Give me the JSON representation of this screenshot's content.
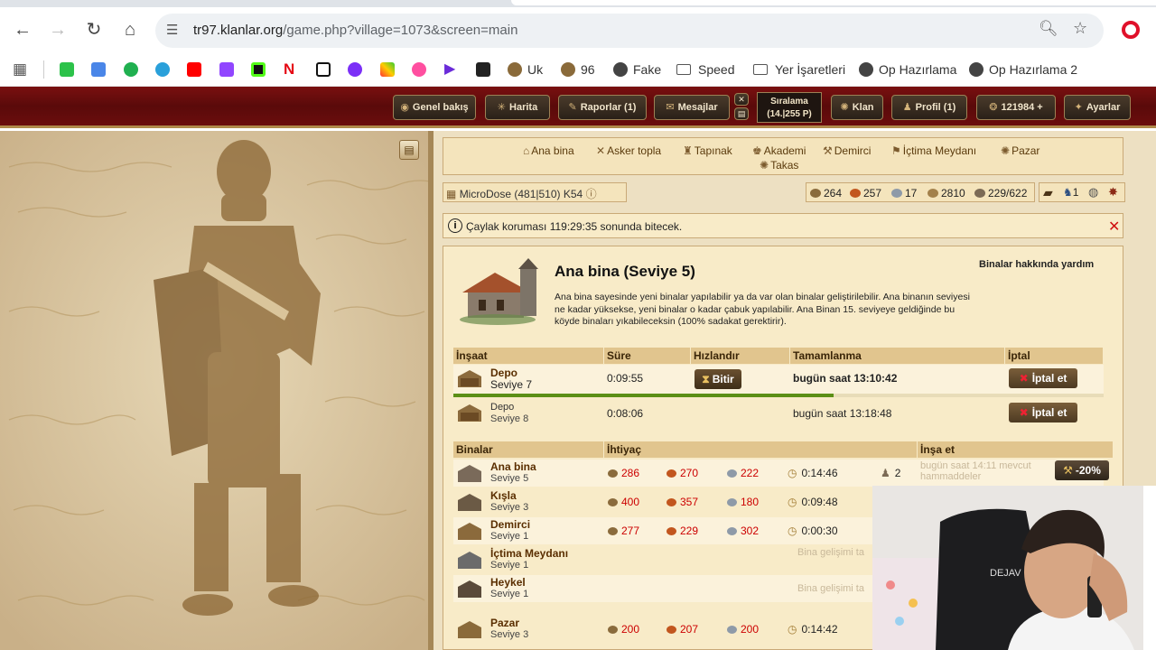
{
  "browser": {
    "url_host": "tr97.klanlar.org",
    "url_path": "/game.php?village=1073&screen=main",
    "bookmarks": [
      "Uk",
      "96",
      "Fake",
      "Speed",
      "Yer İşaretleri",
      "Op Hazırlama",
      "Op Hazırlama 2"
    ]
  },
  "topnav": {
    "overview": "Genel bakış",
    "map": "Harita",
    "reports": "Raporlar (1)",
    "messages": "Mesajlar",
    "rank_label": "Sıralama",
    "rank_value": "(14.|255 P)",
    "clan": "Klan",
    "profile": "Profil (1)",
    "premium": "121984 +",
    "settings": "Ayarlar"
  },
  "building_menu": [
    "Ana bina",
    "Asker topla",
    "Tapınak",
    "Akademi",
    "Demirci",
    "İçtima Meydanı",
    "Pazar",
    "Takas"
  ],
  "village": "MicroDose (481|510) K54",
  "resources": {
    "wood": "264",
    "clay": "257",
    "iron": "17",
    "storage": "2810",
    "population": "229/622",
    "units": "1"
  },
  "notice": "Çaylak koruması 119:29:35 sonunda bitecek.",
  "main": {
    "title": "Ana bina (Seviye 5)",
    "help_link": "Binalar hakkında yardım",
    "description": "Ana bina sayesinde yeni binalar yapılabilir ya da var olan binalar geliştirilebilir. Ana binanın seviyesi ne kadar yüksekse, yeni binalar o kadar çabuk yapılabilir. Ana Binan 15. seviyeye geldiğinde bu köyde binaları yıkabileceksin (100% sadakat gerektirir).",
    "queue_headers": [
      "İnşaat",
      "Süre",
      "Hızlandır",
      "Tamamlanma",
      "İptal"
    ],
    "queue": [
      {
        "name": "Depo",
        "level": "Seviye 7",
        "duration": "0:09:55",
        "speedup": "Bitir",
        "completion": "bugün saat 13:10:42",
        "cancel": "İptal et"
      },
      {
        "name": "Depo",
        "level": "Seviye 8",
        "duration": "0:08:06",
        "completion": "bugün saat 13:18:48",
        "cancel": "İptal et"
      }
    ],
    "queue_progress": 0.585,
    "build_headers": [
      "Binalar",
      "İhtiyaç",
      "İnşa et"
    ],
    "buildings": [
      {
        "name": "Ana bina",
        "level": "Seviye 5",
        "wood": "286",
        "clay": "270",
        "iron": "222",
        "time": "0:14:46",
        "pop": "2",
        "note": "bugün saat 14:11 mevcut hammaddeler",
        "discount": "-20%"
      },
      {
        "name": "Kışla",
        "level": "Seviye 3",
        "wood": "400",
        "clay": "357",
        "iron": "180",
        "time": "0:09:48"
      },
      {
        "name": "Demirci",
        "level": "Seviye 1",
        "wood": "277",
        "clay": "229",
        "iron": "302",
        "time": "0:00:30"
      },
      {
        "name": "İçtima Meydanı",
        "level": "Seviye 1",
        "note": "Bina gelişimi ta"
      },
      {
        "name": "Heykel",
        "level": "Seviye 1",
        "note": "Bina gelişimi ta"
      },
      {
        "name": "Pazar",
        "level": "Seviye 3",
        "wood": "200",
        "clay": "207",
        "iron": "200",
        "time": "0:14:42"
      }
    ]
  },
  "webcam": {
    "shirt_text": "DEJAV"
  }
}
